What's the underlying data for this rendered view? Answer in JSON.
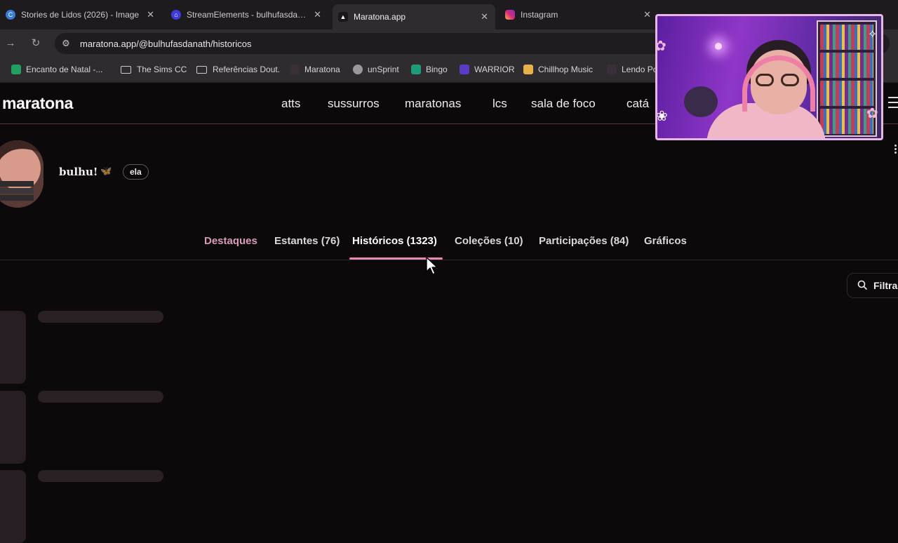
{
  "browser": {
    "tabs": [
      {
        "title": "Stories de Lidos (2026) - Image",
        "icon": "cloud-image-icon",
        "color": "#3a7bd5"
      },
      {
        "title": "StreamElements - bulhufasdanath",
        "icon": "streamelements-icon",
        "color": "#3e3bd9"
      },
      {
        "title": "Maratona.app",
        "icon": "maratona-icon",
        "color": "#1b1619",
        "active": true
      },
      {
        "title": "Instagram",
        "icon": "instagram-icon",
        "color": "#d6287a"
      }
    ],
    "tab_close_glyph": "✕",
    "url": "maratona.app/@bulhufasdanath/historicos",
    "bookmarks": [
      {
        "label": "Encanto de Natal -...",
        "icon": "green-doc-icon",
        "color": "#22a061"
      },
      {
        "label": "The Sims CC",
        "icon": "folder-icon"
      },
      {
        "label": "Referências Dout.",
        "icon": "folder-icon"
      },
      {
        "label": "Maratona",
        "icon": "maratona-icon",
        "color": "#2a2028"
      },
      {
        "label": "unSprint",
        "icon": "globe-icon",
        "color": "#9c979a"
      },
      {
        "label": "Bingo",
        "icon": "bingo-icon",
        "color": "#1f9b79"
      },
      {
        "label": "WARRIOR",
        "icon": "warrior-icon",
        "color": "#5a3bc4"
      },
      {
        "label": "Chillhop Music",
        "icon": "chillhop-icon",
        "color": "#e8b04a"
      },
      {
        "label": "Lendo Po",
        "icon": "maratona-icon",
        "color": "#2a2028"
      }
    ]
  },
  "site": {
    "logo": "maratona",
    "nav": [
      "atts",
      "sussurros",
      "maratonas",
      "lcs",
      "sala de foco",
      "catá"
    ],
    "profile": {
      "username": "bulhu!",
      "emoji": "🦋",
      "pronoun": "ela"
    },
    "tabs": [
      {
        "label": "Destaques"
      },
      {
        "label": "Estantes (76)"
      },
      {
        "label": "Históricos (1323)",
        "active": true
      },
      {
        "label": "Coleções (10)"
      },
      {
        "label": "Participações (84)"
      },
      {
        "label": "Gráficos"
      }
    ],
    "filter_label": "Filtra",
    "accent": "#e789b4"
  }
}
